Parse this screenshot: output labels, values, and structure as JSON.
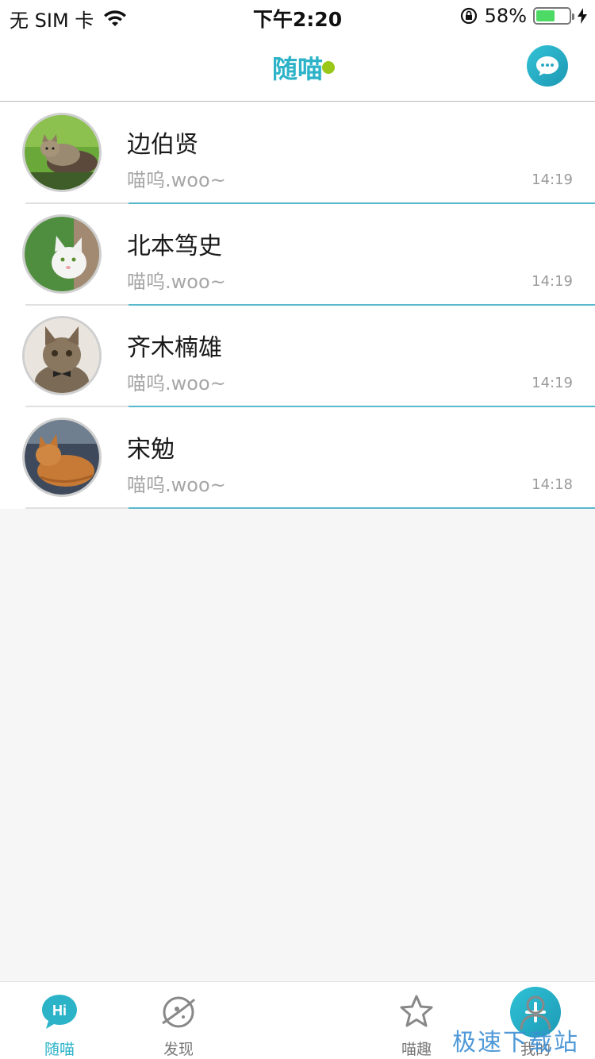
{
  "status": {
    "carrier": "无 SIM 卡",
    "time": "下午2:20",
    "battery_percent": "58%",
    "battery_level": 0.58
  },
  "nav": {
    "title": "随喵",
    "online_color": "#9ac818",
    "accent": "#2cb3c8",
    "message_icon": "chat-bubble-icon"
  },
  "chats": [
    {
      "name": "边伯贤",
      "preview": "喵呜.woo~",
      "time": "14:19",
      "avatar": "cat-grass-avatar"
    },
    {
      "name": "北本笃史",
      "preview": "喵呜.woo~",
      "time": "14:19",
      "avatar": "white-cat-avatar"
    },
    {
      "name": "齐木楠雄",
      "preview": "喵呜.woo~",
      "time": "14:19",
      "avatar": "kitten-bowtie-avatar"
    },
    {
      "name": "宋勉",
      "preview": "喵呜.woo~",
      "time": "14:18",
      "avatar": "orange-cat-avatar"
    }
  ],
  "tabs": [
    {
      "label": "随喵",
      "icon": "hi-bubble-icon",
      "active": true
    },
    {
      "label": "发现",
      "icon": "planet-icon",
      "active": false
    },
    {
      "label": "",
      "icon": "plus-icon",
      "active": false
    },
    {
      "label": "喵趣",
      "icon": "star-icon",
      "active": false
    },
    {
      "label": "我的",
      "icon": "person-icon",
      "active": false
    }
  ],
  "watermark": "极速下载站"
}
